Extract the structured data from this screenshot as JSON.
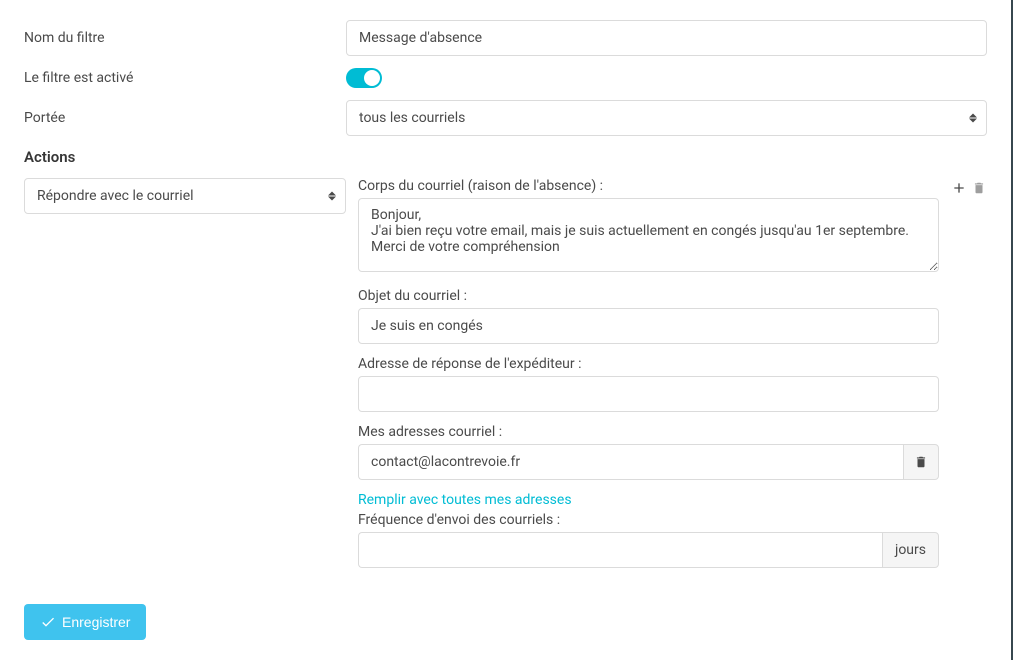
{
  "filter": {
    "name_label": "Nom du filtre",
    "name_value": "Message d'absence",
    "enabled_label": "Le filtre est activé",
    "scope_label": "Portée",
    "scope_value": "tous les courriels"
  },
  "actions": {
    "header": "Actions",
    "selected": "Répondre avec le courriel",
    "body_label": "Corps du courriel (raison de l'absence) :",
    "body_value": "Bonjour,\nJ'ai bien reçu votre email, mais je suis actuellement en congés jusqu'au 1er septembre.\nMerci de votre compréhension",
    "subject_label": "Objet du courriel :",
    "subject_value": "Je suis en congés",
    "replyto_label": "Adresse de réponse de l'expéditeur :",
    "replyto_value": "",
    "myaddr_label": "Mes adresses courriel :",
    "myaddr_value": "contact@lacontrevoie.fr",
    "fill_link": "Remplir avec toutes mes adresses",
    "freq_label": "Fréquence d'envoi des courriels :",
    "freq_value": "",
    "freq_unit": "jours"
  },
  "buttons": {
    "save": "Enregistrer"
  }
}
